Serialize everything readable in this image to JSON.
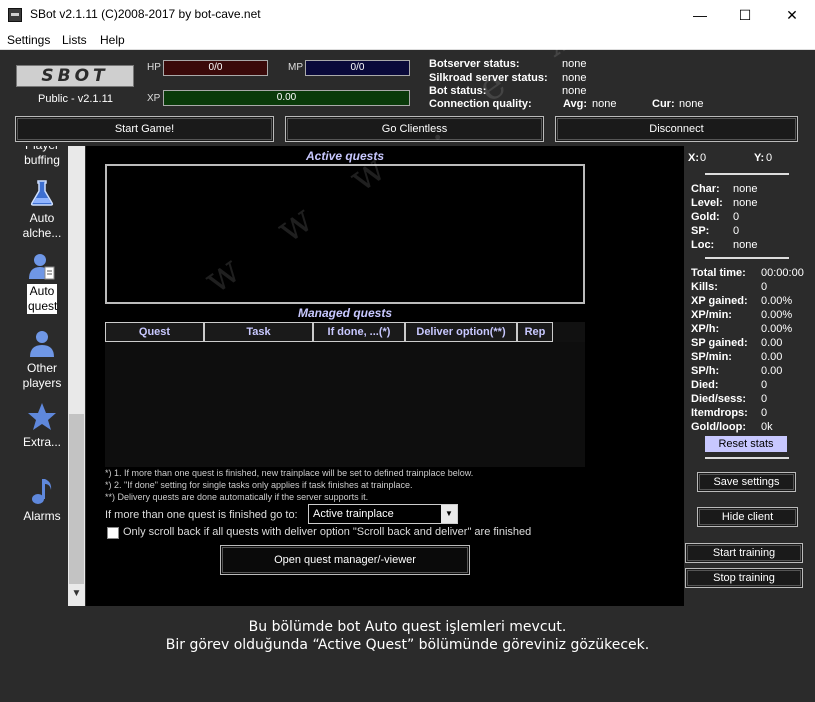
{
  "window": {
    "title": "SBot v2.1.11 (C)2008-2017 by bot-cave.net",
    "minimize": "—",
    "maximize": "☐",
    "close": "✕"
  },
  "menu": [
    "Settings",
    "Lists",
    "Help"
  ],
  "logo": "SBOT",
  "version": "Public - v2.1.11",
  "bars": {
    "hp": {
      "label": "HP",
      "value": "0/0",
      "color": "#3a0a0a"
    },
    "mp": {
      "label": "MP",
      "value": "0/0",
      "color": "#0a0a3a"
    },
    "xp": {
      "label": "XP",
      "value": "0.00",
      "color": "#0a3a0a"
    }
  },
  "status": {
    "botserver_label": "Botserver status:",
    "botserver_value": "none",
    "silkroad_label": "Silkroad server status:",
    "silkroad_value": "none",
    "bot_label": "Bot status:",
    "bot_value": "none",
    "conn_label": "Connection quality:",
    "avg_label": "Avg:",
    "avg_value": "none",
    "cur_label": "Cur:",
    "cur_value": "none"
  },
  "top_buttons": {
    "start_game": "Start Game!",
    "go_clientless": "Go Clientless",
    "disconnect": "Disconnect"
  },
  "sidebar": [
    {
      "label": "Player buffing",
      "icon": "player-buffing-icon"
    },
    {
      "label": "Auto alche...",
      "icon": "flask-icon"
    },
    {
      "label": "Auto quest",
      "icon": "quest-player-icon",
      "active": true
    },
    {
      "label": "Other players",
      "icon": "player-icon"
    },
    {
      "label": "Extra...",
      "icon": "star-icon"
    },
    {
      "label": "Alarms",
      "icon": "music-note-icon"
    }
  ],
  "main": {
    "active_quests_title": "Active quests",
    "managed_quests_title": "Managed quests",
    "columns": [
      "Quest",
      "Task",
      "If done, ...(*)",
      "Deliver option(**)",
      "Rep"
    ],
    "notes": [
      "*) 1. If more than one quest is finished, new trainplace will be set to defined trainplace below.",
      "*) 2. \"If done\" setting for single tasks only applies if task finishes at trainplace.",
      "**) Delivery quests are done automatically if the server supports it."
    ],
    "goto_label": "If more than one quest is finished go to:",
    "goto_value": "Active trainplace",
    "scroll_back_label": "Only scroll back if all quests with deliver option \"Scroll back and deliver\" are finished",
    "open_manager": "Open quest manager/-viewer",
    "watermark": "w w w . e x t r a l o o b . c o m"
  },
  "right": {
    "x_label": "X:",
    "x_value": "0",
    "y_label": "Y:",
    "y_value": "0",
    "char": [
      {
        "k": "Char:",
        "v": "none"
      },
      {
        "k": "Level:",
        "v": "none"
      },
      {
        "k": "Gold:",
        "v": "0"
      },
      {
        "k": "SP:",
        "v": "0"
      },
      {
        "k": "Loc:",
        "v": "none"
      }
    ],
    "stats": [
      {
        "k": "Total time:",
        "v": "00:00:00"
      },
      {
        "k": "Kills:",
        "v": "0"
      },
      {
        "k": "XP gained:",
        "v": "0.00%"
      },
      {
        "k": "XP/min:",
        "v": "0.00%"
      },
      {
        "k": "XP/h:",
        "v": "0.00%"
      },
      {
        "k": "SP gained:",
        "v": "0.00"
      },
      {
        "k": "SP/min:",
        "v": "0.00"
      },
      {
        "k": "SP/h:",
        "v": "0.00"
      },
      {
        "k": "Died:",
        "v": "0"
      },
      {
        "k": "Died/sess:",
        "v": "0"
      },
      {
        "k": "Itemdrops:",
        "v": "0"
      },
      {
        "k": "Gold/loop:",
        "v": "0k"
      }
    ],
    "reset_stats": "Reset stats",
    "save_settings": "Save settings",
    "hide_client": "Hide client",
    "start_training": "Start training",
    "stop_training": "Stop training"
  },
  "caption": {
    "line1": "Bu bölümde bot Auto quest işlemleri mevcut.",
    "line2": "Bir görev olduğunda “Active Quest” bölümünde göreviniz gözükecek."
  }
}
